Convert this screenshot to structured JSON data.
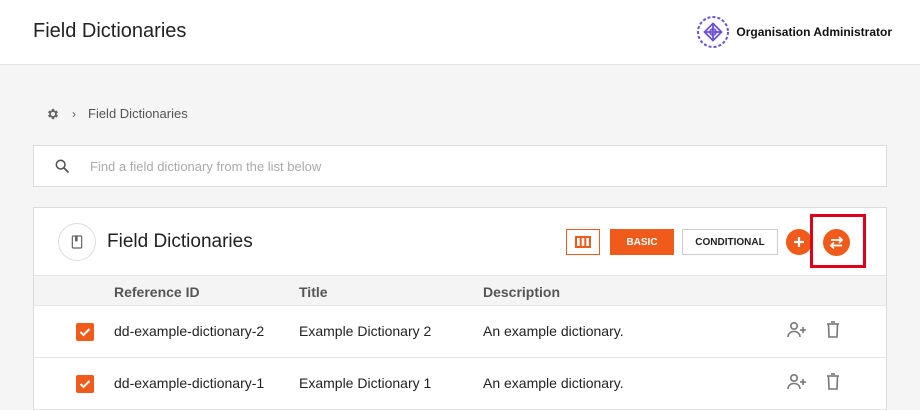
{
  "header": {
    "title": "Field Dictionaries",
    "org_name": "Organisation Administrator"
  },
  "breadcrumb": {
    "home_icon": "gear-icon",
    "separator": "›",
    "current": "Field Dictionaries"
  },
  "search": {
    "placeholder": "Find a field dictionary from the list below",
    "value": ""
  },
  "panel": {
    "title": "Field Dictionaries",
    "buttons": {
      "columns_icon": "columns-icon",
      "basic_label": "BASIC",
      "conditional_label": "CONDITIONAL",
      "add_icon": "plus-icon",
      "swap_icon": "swap-icon"
    }
  },
  "table": {
    "columns": [
      "Reference ID",
      "Title",
      "Description"
    ],
    "rows": [
      {
        "checked": true,
        "reference_id": "dd-example-dictionary-2",
        "title": "Example Dictionary 2",
        "description": "An example dictionary."
      },
      {
        "checked": true,
        "reference_id": "dd-example-dictionary-1",
        "title": "Example Dictionary 1",
        "description": "An example dictionary."
      }
    ]
  },
  "colors": {
    "accent": "#f05a1a",
    "highlight": "#e0001b",
    "logo": "#6b4fd8"
  }
}
